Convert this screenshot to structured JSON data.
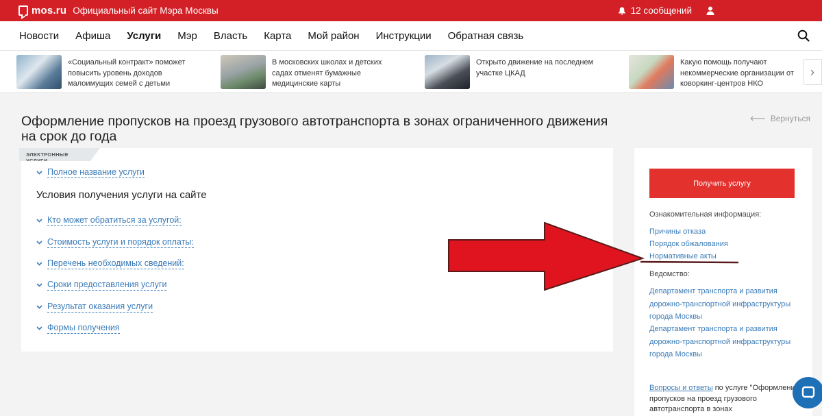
{
  "topbar": {
    "logo": "mos.ru",
    "site_title": "Официальный сайт Мэра Москвы",
    "messages": "12 сообщений",
    "icons": [
      "logo-icon",
      "bell-icon",
      "user-icon"
    ],
    "color": "#d32026"
  },
  "nav": {
    "items": [
      "Новости",
      "Афиша",
      "Услуги",
      "Мэр",
      "Власть",
      "Карта",
      "Мой район",
      "Инструкции",
      "Обратная связь"
    ],
    "active": "Услуги"
  },
  "news": [
    {
      "text": "«Социальный контракт» поможет повысить уровень доходов малоимущих семей с детьми"
    },
    {
      "text": "В московских школах и детских садах отменят бумажные медицинские карты"
    },
    {
      "text": "Открыто движение на последнем участке ЦКАД"
    },
    {
      "text": "Какую помощь получают некоммерческие организации от коворкинг-центров НКО"
    }
  ],
  "page": {
    "title": "Оформление пропусков на проезд грузового автотранспорта в зонах ограниченного движения на срок до года",
    "back": "Вернуться"
  },
  "main": {
    "tag": "ЭЛЕКТРОННЫЕ УСЛУГИ",
    "full_name": "Полное название услуги",
    "section_title": "Условия получения услуги на сайте",
    "accordion": [
      "Кто может обратиться за услугой:",
      "Стоимость услуги и порядок оплаты:",
      "Перечень необходимых сведений:",
      "Сроки предоставления услуги",
      "Результат оказания услуги",
      "Формы получения"
    ]
  },
  "sidebar": {
    "button": "Получить услугу",
    "info_label": "Ознакомительная информация:",
    "info_links": [
      "Причины отказа",
      "Порядок обжалования",
      "Нормативные акты"
    ],
    "dept_label": "Ведомство:",
    "dept_links": [
      "Департамент транспорта и развития дорожно-транспортной инфраструктуры города Москвы",
      "Департамент транспорта и развития дорожно-транспортной инфраструктуры города Москвы"
    ],
    "faq_link": "Вопросы и ответы",
    "faq_rest": " по услуге \"Оформление пропусков на проезд грузового автотранспорта в зонах"
  },
  "colors": {
    "accent": "#e3312d",
    "link": "#3a7bb8",
    "annotation": "#e0141e"
  }
}
